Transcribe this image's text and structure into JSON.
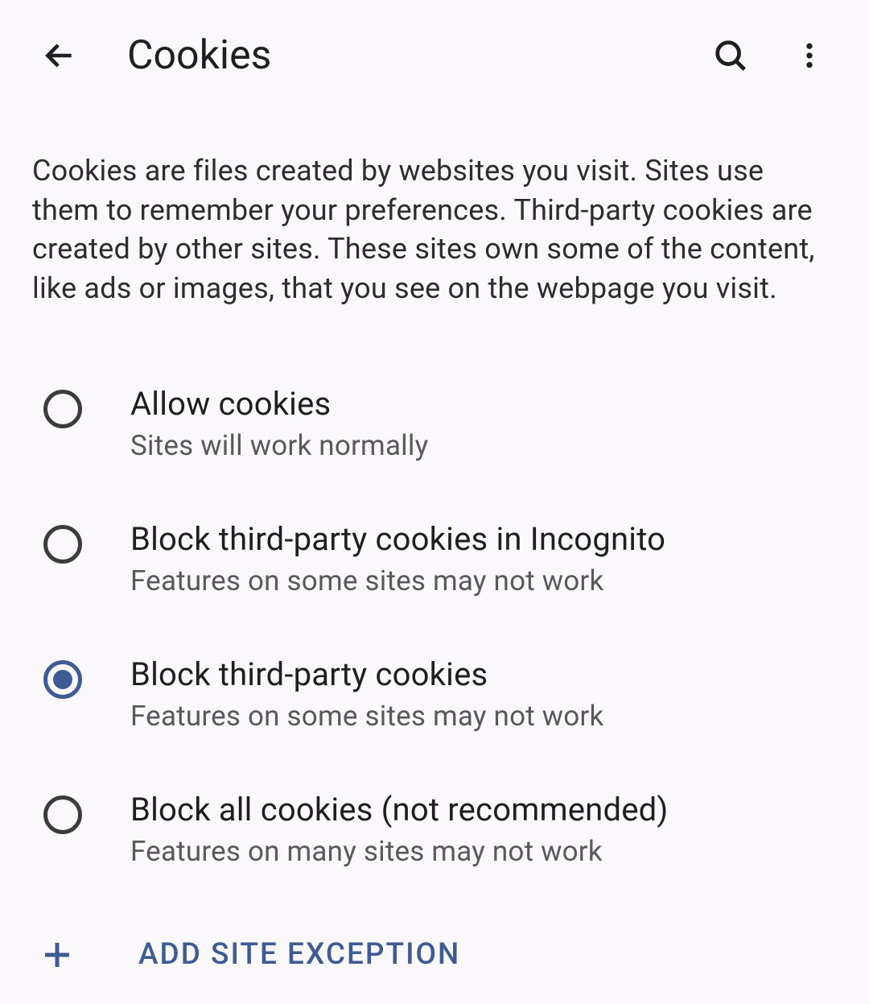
{
  "header": {
    "title": "Cookies"
  },
  "description": "Cookies are files created by websites you visit. Sites use them to remember your preferences. Third-party cookies are created by other sites. These sites own some of the content, like ads or images, that you see on the webpage you visit.",
  "options": [
    {
      "title": "Allow cookies",
      "subtitle": "Sites will work normally",
      "selected": false
    },
    {
      "title": "Block third-party cookies in Incognito",
      "subtitle": "Features on some sites may not work",
      "selected": false
    },
    {
      "title": "Block third-party cookies",
      "subtitle": "Features on some sites may not work",
      "selected": true
    },
    {
      "title": "Block all cookies (not recommended)",
      "subtitle": "Features on many sites may not work",
      "selected": false
    }
  ],
  "addException": {
    "label": "ADD SITE EXCEPTION"
  }
}
